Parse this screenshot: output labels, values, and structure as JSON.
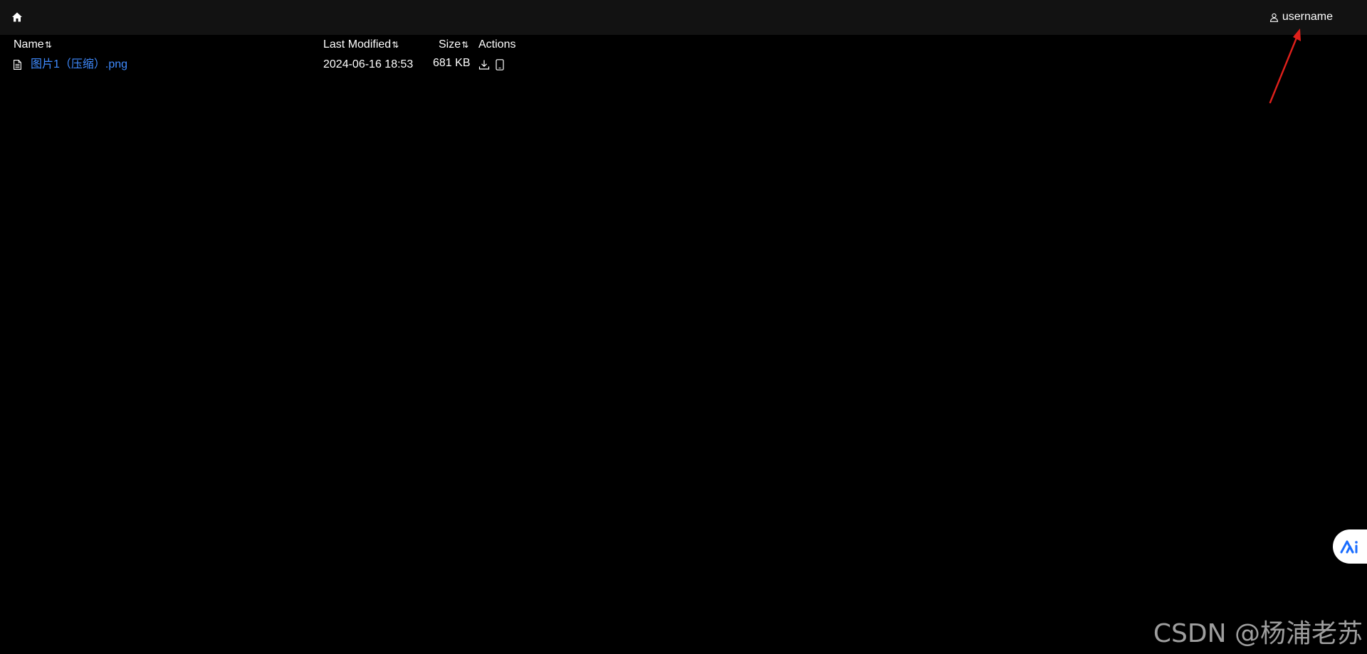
{
  "topbar": {
    "home_icon": "home-icon",
    "user_icon": "user-icon",
    "username": "username"
  },
  "table": {
    "headers": {
      "name": "Name",
      "last_modified": "Last Modified",
      "size": "Size",
      "actions": "Actions"
    },
    "sort_icon": "⇅",
    "rows": [
      {
        "icon": "file-icon",
        "name": "图片1（压缩）.png",
        "last_modified": "2024-06-16 18:53",
        "size": "681 KB",
        "actions": [
          "download-icon",
          "mobile-icon"
        ]
      }
    ]
  },
  "annotation": {
    "arrow_color": "#e0201b"
  },
  "floating_button": {
    "icon": "ai-assistant-icon"
  },
  "watermark": {
    "text": "CSDN @杨浦老苏"
  },
  "colors": {
    "background": "#000000",
    "topbar": "#121212",
    "link": "#3f8bff",
    "text": "#ffffff"
  }
}
